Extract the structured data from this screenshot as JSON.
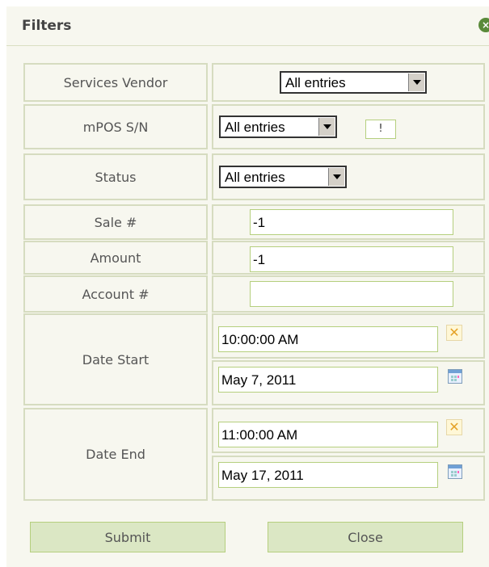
{
  "dialog": {
    "title": "Filters",
    "close_icon": "close-icon"
  },
  "rows": {
    "services_vendor": {
      "label": "Services Vendor",
      "value": "All entries"
    },
    "mpos_sn": {
      "label": "mPOS S/N",
      "value": "All entries",
      "button_label": "!"
    },
    "status": {
      "label": "Status",
      "value": "All entries"
    },
    "sale": {
      "label": "Sale #",
      "value": "-1"
    },
    "amount": {
      "label": "Amount",
      "value": "-1"
    },
    "account": {
      "label": "Account #",
      "value": ""
    },
    "date_start": {
      "label": "Date Start",
      "time": "10:00:00 AM",
      "date": "May 7, 2011"
    },
    "date_end": {
      "label": "Date End",
      "time": "11:00:00 AM",
      "date": "May 17, 2011"
    }
  },
  "buttons": {
    "submit": "Submit",
    "close": "Close"
  },
  "colors": {
    "background": "#f7f7ef",
    "border": "#d6dcc0",
    "button": "#dbe7c4",
    "input_border": "#b5cf7e"
  }
}
